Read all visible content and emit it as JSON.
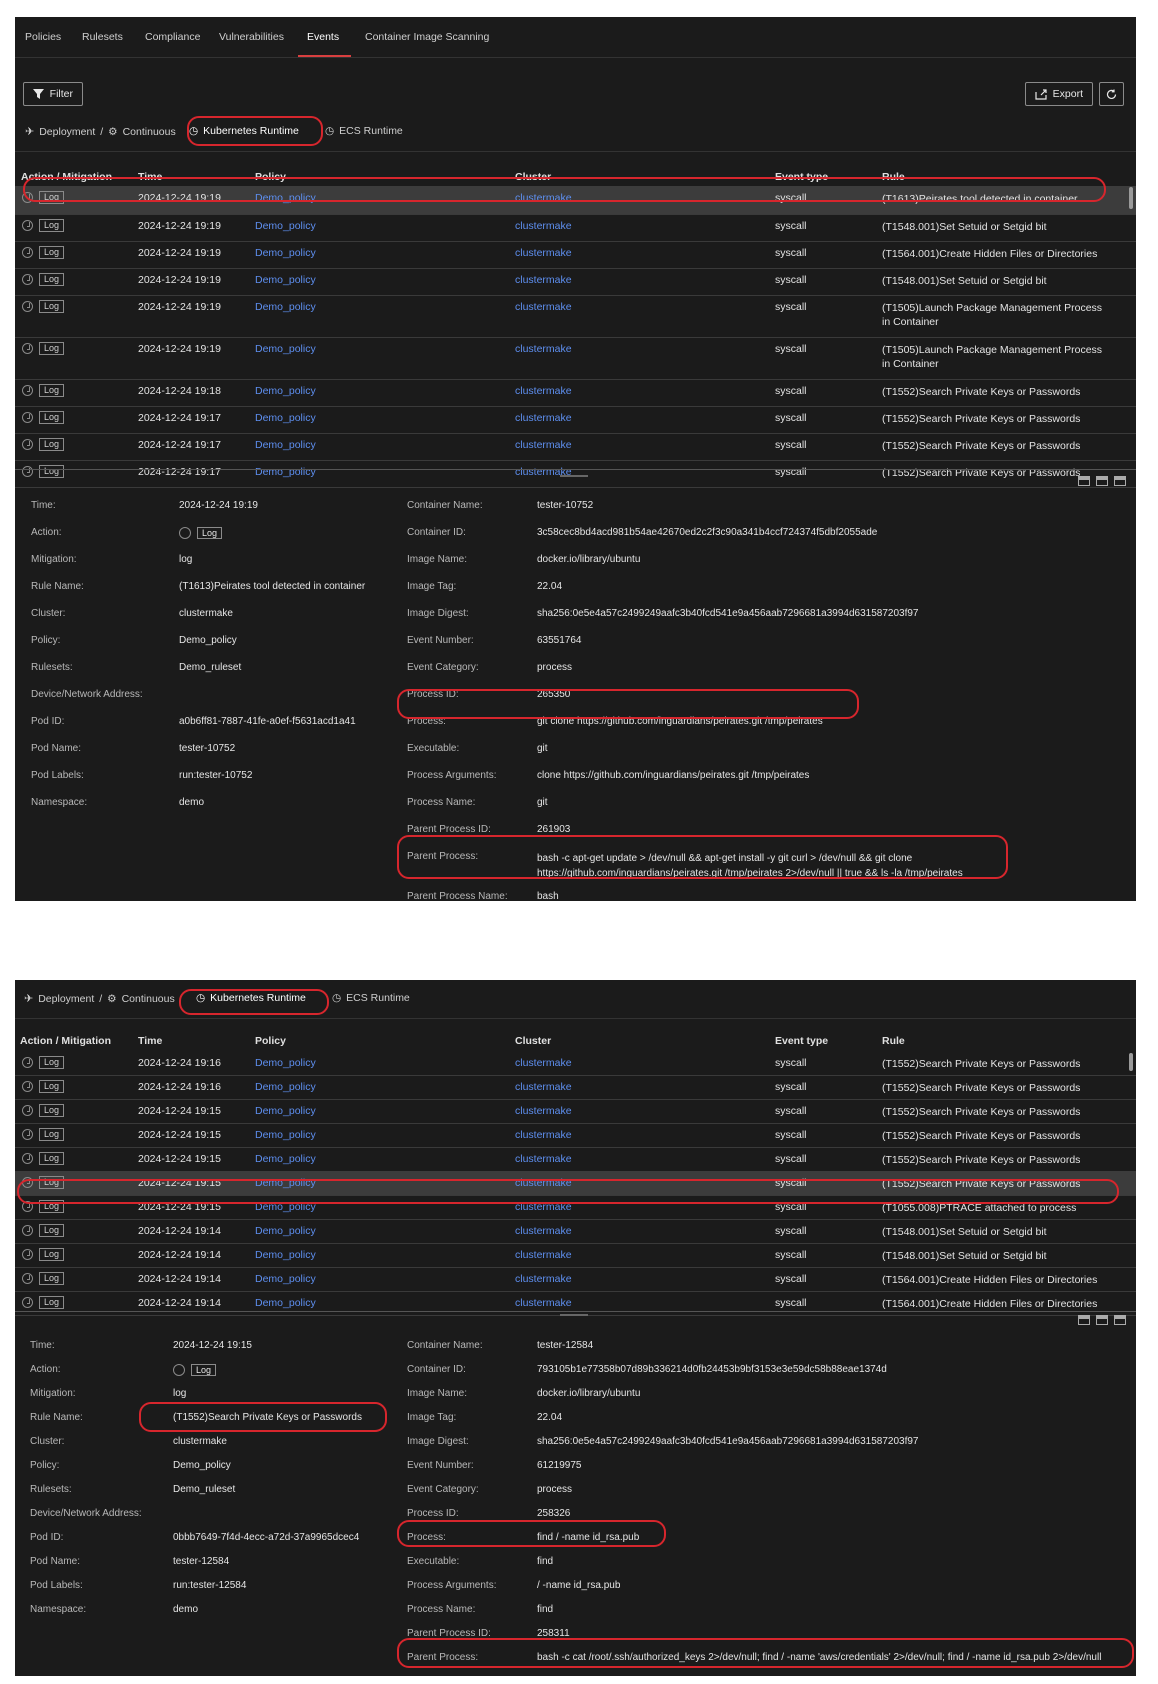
{
  "top_tabs": [
    "Policies",
    "Rulesets",
    "Compliance",
    "Vulnerabilities",
    "Events",
    "Container Image Scanning"
  ],
  "active_top_tab": "Events",
  "toolbar": {
    "filter_label": "Filter",
    "export_label": "Export"
  },
  "runtime_tabs": {
    "deployment": "Deployment",
    "continuous": "Continuous",
    "kubernetes": "Kubernetes Runtime",
    "ecs": "ECS Runtime"
  },
  "columns": [
    "Action / Mitigation",
    "Time",
    "Policy",
    "Cluster",
    "Event type",
    "Rule"
  ],
  "panel1": {
    "rows": [
      {
        "action": "Log",
        "time": "2024-12-24 19:19",
        "policy": "Demo_policy",
        "cluster": "clustermake",
        "type": "syscall",
        "rule": "(T1613)Peirates tool detected in container",
        "selected": true
      },
      {
        "action": "Log",
        "time": "2024-12-24 19:19",
        "policy": "Demo_policy",
        "cluster": "clustermake",
        "type": "syscall",
        "rule": "(T1548.001)Set Setuid or Setgid bit"
      },
      {
        "action": "Log",
        "time": "2024-12-24 19:19",
        "policy": "Demo_policy",
        "cluster": "clustermake",
        "type": "syscall",
        "rule": "(T1564.001)Create Hidden Files or Directories"
      },
      {
        "action": "Log",
        "time": "2024-12-24 19:19",
        "policy": "Demo_policy",
        "cluster": "clustermake",
        "type": "syscall",
        "rule": "(T1548.001)Set Setuid or Setgid bit"
      },
      {
        "action": "Log",
        "time": "2024-12-24 19:19",
        "policy": "Demo_policy",
        "cluster": "clustermake",
        "type": "syscall",
        "rule": "(T1505)Launch Package Management Process in Container"
      },
      {
        "action": "Log",
        "time": "2024-12-24 19:19",
        "policy": "Demo_policy",
        "cluster": "clustermake",
        "type": "syscall",
        "rule": "(T1505)Launch Package Management Process in Container"
      },
      {
        "action": "Log",
        "time": "2024-12-24 19:18",
        "policy": "Demo_policy",
        "cluster": "clustermake",
        "type": "syscall",
        "rule": "(T1552)Search Private Keys or Passwords"
      },
      {
        "action": "Log",
        "time": "2024-12-24 19:17",
        "policy": "Demo_policy",
        "cluster": "clustermake",
        "type": "syscall",
        "rule": "(T1552)Search Private Keys or Passwords"
      },
      {
        "action": "Log",
        "time": "2024-12-24 19:17",
        "policy": "Demo_policy",
        "cluster": "clustermake",
        "type": "syscall",
        "rule": "(T1552)Search Private Keys or Passwords"
      },
      {
        "action": "Log",
        "time": "2024-12-24 19:17",
        "policy": "Demo_policy",
        "cluster": "clustermake",
        "type": "syscall",
        "rule": "(T1552)Search Private Keys or Passwords"
      }
    ],
    "detail_left": [
      {
        "label": "Time:",
        "value": "2024-12-24 19:19"
      },
      {
        "label": "Action:",
        "value": "Log",
        "kind": "action"
      },
      {
        "label": "Mitigation:",
        "value": "log"
      },
      {
        "label": "Rule Name:",
        "value": "(T1613)Peirates tool detected in container"
      },
      {
        "label": "Cluster:",
        "value": "clustermake",
        "kind": "link"
      },
      {
        "label": "Policy:",
        "value": "Demo_policy",
        "kind": "link"
      },
      {
        "label": "Rulesets:",
        "value": "Demo_ruleset",
        "kind": "link"
      },
      {
        "label": "Device/Network Address:",
        "value": ""
      },
      {
        "label": "Pod ID:",
        "value": "a0b6ff81-7887-41fe-a0ef-f5631acd1a41"
      },
      {
        "label": "Pod Name:",
        "value": "tester-10752"
      },
      {
        "label": "Pod Labels:",
        "value": "run:tester-10752"
      },
      {
        "label": "Namespace:",
        "value": "demo"
      }
    ],
    "detail_right": [
      {
        "label": "Container Name:",
        "value": "tester-10752"
      },
      {
        "label": "Container ID:",
        "value": "3c58cec8bd4acd981b54ae42670ed2c2f3c90a341b4ccf724374f5dbf2055ade"
      },
      {
        "label": "Image Name:",
        "value": "docker.io/library/ubuntu"
      },
      {
        "label": "Image Tag:",
        "value": "22.04"
      },
      {
        "label": "Image Digest:",
        "value": "sha256:0e5e4a57c2499249aafc3b40fcd541e9a456aab7296681a3994d631587203f97"
      },
      {
        "label": "Event Number:",
        "value": "63551764"
      },
      {
        "label": "Event Category:",
        "value": "process"
      },
      {
        "label": "Process ID:",
        "value": "265350"
      },
      {
        "label": "Process:",
        "value": "git clone https://github.com/inguardians/peirates.git /tmp/peirates"
      },
      {
        "label": "Executable:",
        "value": "git"
      },
      {
        "label": "Process Arguments:",
        "value": "clone https://github.com/inguardians/peirates.git /tmp/peirates"
      },
      {
        "label": "Process Name:",
        "value": "git"
      },
      {
        "label": "Parent Process ID:",
        "value": "261903"
      },
      {
        "label": "Parent Process:",
        "value": "bash -c apt-get update > /dev/null && apt-get install -y git curl > /dev/null && git clone https://github.com/inguardians/peirates.git /tmp/peirates 2>/dev/null || true && ls -la /tmp/peirates"
      },
      {
        "label": "Parent Process Name:",
        "value": "bash"
      }
    ]
  },
  "panel2": {
    "rows": [
      {
        "action": "Log",
        "time": "2024-12-24 19:16",
        "policy": "Demo_policy",
        "cluster": "clustermake",
        "type": "syscall",
        "rule": "(T1552)Search Private Keys or Passwords"
      },
      {
        "action": "Log",
        "time": "2024-12-24 19:16",
        "policy": "Demo_policy",
        "cluster": "clustermake",
        "type": "syscall",
        "rule": "(T1552)Search Private Keys or Passwords"
      },
      {
        "action": "Log",
        "time": "2024-12-24 19:15",
        "policy": "Demo_policy",
        "cluster": "clustermake",
        "type": "syscall",
        "rule": "(T1552)Search Private Keys or Passwords"
      },
      {
        "action": "Log",
        "time": "2024-12-24 19:15",
        "policy": "Demo_policy",
        "cluster": "clustermake",
        "type": "syscall",
        "rule": "(T1552)Search Private Keys or Passwords"
      },
      {
        "action": "Log",
        "time": "2024-12-24 19:15",
        "policy": "Demo_policy",
        "cluster": "clustermake",
        "type": "syscall",
        "rule": "(T1552)Search Private Keys or Passwords"
      },
      {
        "action": "Log",
        "time": "2024-12-24 19:15",
        "policy": "Demo_policy",
        "cluster": "clustermake",
        "type": "syscall",
        "rule": "(T1552)Search Private Keys or Passwords",
        "selected": true
      },
      {
        "action": "Log",
        "time": "2024-12-24 19:15",
        "policy": "Demo_policy",
        "cluster": "clustermake",
        "type": "syscall",
        "rule": "(T1055.008)PTRACE attached to process"
      },
      {
        "action": "Log",
        "time": "2024-12-24 19:14",
        "policy": "Demo_policy",
        "cluster": "clustermake",
        "type": "syscall",
        "rule": "(T1548.001)Set Setuid or Setgid bit"
      },
      {
        "action": "Log",
        "time": "2024-12-24 19:14",
        "policy": "Demo_policy",
        "cluster": "clustermake",
        "type": "syscall",
        "rule": "(T1548.001)Set Setuid or Setgid bit"
      },
      {
        "action": "Log",
        "time": "2024-12-24 19:14",
        "policy": "Demo_policy",
        "cluster": "clustermake",
        "type": "syscall",
        "rule": "(T1564.001)Create Hidden Files or Directories"
      },
      {
        "action": "Log",
        "time": "2024-12-24 19:14",
        "policy": "Demo_policy",
        "cluster": "clustermake",
        "type": "syscall",
        "rule": "(T1564.001)Create Hidden Files or Directories"
      }
    ],
    "detail_left": [
      {
        "label": "Time:",
        "value": "2024-12-24 19:15"
      },
      {
        "label": "Action:",
        "value": "Log",
        "kind": "action"
      },
      {
        "label": "Mitigation:",
        "value": "log"
      },
      {
        "label": "Rule Name:",
        "value": "(T1552)Search Private Keys or Passwords"
      },
      {
        "label": "Cluster:",
        "value": "clustermake",
        "kind": "link"
      },
      {
        "label": "Policy:",
        "value": "Demo_policy",
        "kind": "link"
      },
      {
        "label": "Rulesets:",
        "value": "Demo_ruleset",
        "kind": "link"
      },
      {
        "label": "Device/Network Address:",
        "value": ""
      },
      {
        "label": "Pod ID:",
        "value": "0bbb7649-7f4d-4ecc-a72d-37a9965dcec4"
      },
      {
        "label": "Pod Name:",
        "value": "tester-12584"
      },
      {
        "label": "Pod Labels:",
        "value": "run:tester-12584"
      },
      {
        "label": "Namespace:",
        "value": "demo"
      }
    ],
    "detail_right": [
      {
        "label": "Container Name:",
        "value": "tester-12584"
      },
      {
        "label": "Container ID:",
        "value": "793105b1e77358b07d89b336214d0fb24453b9bf3153e3e59dc58b88eae1374d"
      },
      {
        "label": "Image Name:",
        "value": "docker.io/library/ubuntu"
      },
      {
        "label": "Image Tag:",
        "value": "22.04"
      },
      {
        "label": "Image Digest:",
        "value": "sha256:0e5e4a57c2499249aafc3b40fcd541e9a456aab7296681a3994d631587203f97"
      },
      {
        "label": "Event Number:",
        "value": "61219975"
      },
      {
        "label": "Event Category:",
        "value": "process"
      },
      {
        "label": "Process ID:",
        "value": "258326"
      },
      {
        "label": "Process:",
        "value": "find / -name id_rsa.pub"
      },
      {
        "label": "Executable:",
        "value": "find"
      },
      {
        "label": "Process Arguments:",
        "value": "/ -name id_rsa.pub"
      },
      {
        "label": "Process Name:",
        "value": "find"
      },
      {
        "label": "Parent Process ID:",
        "value": "258311"
      },
      {
        "label": "Parent Process:",
        "value": "bash -c cat /root/.ssh/authorized_keys 2>/dev/null; find / -name 'aws/credentials' 2>/dev/null; find / -name id_rsa.pub 2>/dev/null"
      },
      {
        "label": "Parent Process Name:",
        "value": "bash"
      }
    ]
  },
  "colors": {
    "panel_bg": "#1b1b1b",
    "link": "#5e8ff0",
    "highlight": "#d7262d",
    "accent_tab": "#d93f3f"
  }
}
